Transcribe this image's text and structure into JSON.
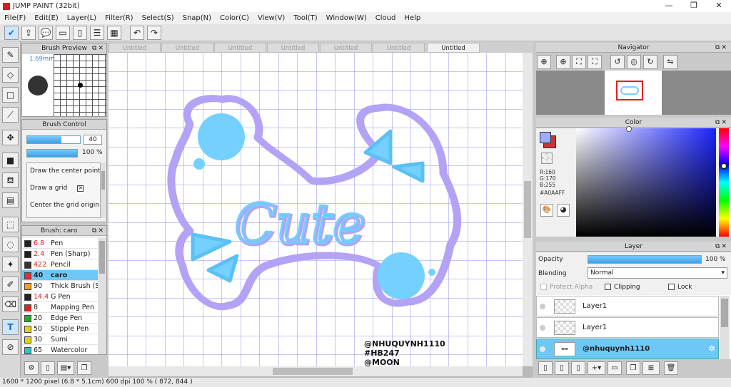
{
  "app": {
    "title": "JUMP PAINT (32bit)"
  },
  "window_controls": {
    "minimize": "—",
    "maximize": "❐",
    "close": "✕"
  },
  "menu": [
    "File(F)",
    "Edit(E)",
    "Layer(L)",
    "Filter(R)",
    "Select(S)",
    "Snap(N)",
    "Color(C)",
    "View(V)",
    "Tool(T)",
    "Window(W)",
    "Cloud",
    "Help"
  ],
  "brush_preview": {
    "title": "Brush Preview",
    "size_label": "1.69mm"
  },
  "brush_control": {
    "title": "Brush Control",
    "size_value": "40",
    "size_fill": 0.65,
    "opacity_value": "100 %",
    "opacity_fill": 1.0,
    "options": [
      "Draw the center point",
      "Draw a grid",
      "Center the grid origin"
    ]
  },
  "brush_list": {
    "title": "Brush: caro",
    "items": [
      {
        "size": "6.8",
        "name": "Pen",
        "color": "#222222",
        "red": true
      },
      {
        "size": "2.4",
        "name": "Pen (Sharp)",
        "color": "#222222",
        "red": true
      },
      {
        "size": "422",
        "name": "Pencil",
        "color": "#333333",
        "red": true
      },
      {
        "size": "40",
        "name": "caro",
        "color": "#e03030",
        "red": false,
        "selected": true
      },
      {
        "size": "90",
        "name": "Thick Brush (Sumi)",
        "color": "#f0a020",
        "red": false
      },
      {
        "size": "14.4",
        "name": "G Pen",
        "color": "#222222",
        "red": true
      },
      {
        "size": "8",
        "name": "Mapping Pen",
        "color": "#e02020",
        "red": false
      },
      {
        "size": "20",
        "name": "Edge Pen",
        "color": "#20b020",
        "red": false
      },
      {
        "size": "50",
        "name": "Stipple Pen",
        "color": "#e0d020",
        "red": false
      },
      {
        "size": "30",
        "name": "Sumi",
        "color": "#e0d020",
        "red": false
      },
      {
        "size": "65",
        "name": "Watercolor",
        "color": "#30c0d0",
        "red": false
      }
    ]
  },
  "tabs": [
    "Untitled",
    "Untitled",
    "Untitled",
    "Untitled",
    "Untitled",
    "Untitled",
    "Untitled"
  ],
  "canvas": {
    "word": "Cute",
    "credits": [
      "@NHUQUYNH1110",
      "#HB247",
      "@MOON"
    ]
  },
  "navigator": {
    "title": "Navigator"
  },
  "color": {
    "title": "Color",
    "r": "R:160",
    "g": "G:170",
    "b": "B:255",
    "hex": "#A0AAFF",
    "main": "#a0aaff",
    "sub": "#d03030"
  },
  "layer": {
    "title": "Layer",
    "opacity_label": "Opacity",
    "opacity_value": "100 %",
    "opacity_fill": 1.0,
    "blending_label": "Blending",
    "blending_value": "Normal",
    "protect_alpha": "Protect Alpha",
    "clipping": "Clipping",
    "lock": "Lock",
    "layers": [
      {
        "name": "Layer1"
      },
      {
        "name": "Layer1"
      },
      {
        "name": "@nhuquynh1110",
        "selected": true
      }
    ]
  },
  "status": {
    "text": "1600 * 1200 pixel  (6.8 * 5.1cm)  600 dpi  100 %  ( 872, 844 )"
  }
}
